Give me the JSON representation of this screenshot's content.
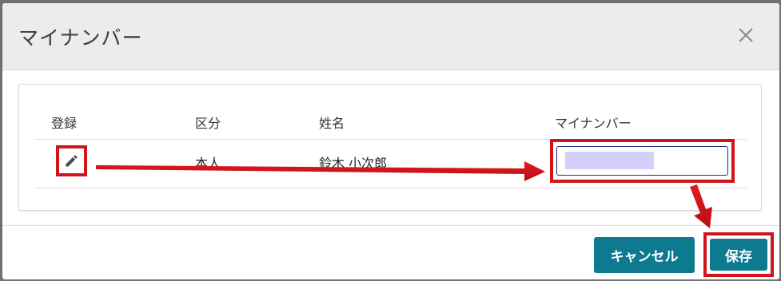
{
  "dialog": {
    "title": "マイナンバー",
    "close_icon": "close-icon"
  },
  "table": {
    "headers": {
      "register": "登録",
      "category": "区分",
      "name": "姓名",
      "my_number": "マイナンバー"
    },
    "row": {
      "edit_icon": "pencil-icon",
      "category": "本人",
      "name": "鈴木 小次郎",
      "my_number_value": ""
    }
  },
  "footer": {
    "cancel_label": "キャンセル",
    "save_label": "保存"
  },
  "colors": {
    "accent": "#0e7a8f",
    "highlight": "#d1141b",
    "redaction": "#d4d0fb"
  }
}
